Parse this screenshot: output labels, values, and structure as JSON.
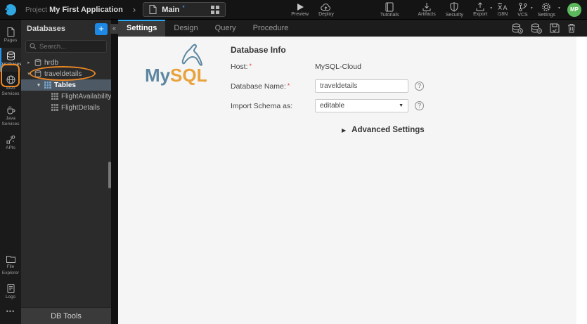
{
  "ui": {
    "required_marker": "*",
    "icons": {
      "chevron_right": "›",
      "collapse_left": "«",
      "tree_collapsed": "▸",
      "tree_expanded": "▾",
      "dropdown_caret": "▼",
      "section_collapsed": "▶",
      "help": "?",
      "unsaved_dot": "*",
      "more": "•••",
      "menu_caret": "▾",
      "add": "+"
    },
    "colors": {
      "accent_blue": "#2196f3",
      "tab_active_blue": "#29a9f4",
      "annotation_orange": "#ee8822",
      "avatar_green": "#5cb85c",
      "selected_row": "#4d5a66",
      "required_red": "#e53935",
      "mysql_blue": "#5d87a1",
      "mysql_orange": "#e8a33d"
    }
  },
  "topbar": {
    "project_prefix": "Project",
    "project_name": "My First Application",
    "page_tab": "Main",
    "actions": {
      "preview": "Preview",
      "deploy": "Deploy",
      "tutorials": "Tutorials",
      "artifacts": "Artifacts",
      "security": "Security",
      "export": "Export",
      "i18n": "I18N",
      "vcs": "VCS",
      "settings": "Settings"
    },
    "avatar_initials": "MP"
  },
  "rail": {
    "items": [
      {
        "label": "Pages"
      },
      {
        "label": "Databases",
        "active": true,
        "annotated": true
      },
      {
        "label": "Web Services"
      },
      {
        "label": "Java Services"
      },
      {
        "label": "APIs"
      }
    ],
    "bottom_items": [
      {
        "label": "File Explorer"
      },
      {
        "label": "Logs"
      }
    ]
  },
  "panel": {
    "title": "Databases",
    "search_placeholder": "Search...",
    "tree": [
      {
        "label": "hrdb",
        "level": 0,
        "expanded": false,
        "type": "database"
      },
      {
        "label": "traveldetails",
        "level": 0,
        "expanded": true,
        "type": "database",
        "annotated": true
      },
      {
        "label": "Tables",
        "level": 1,
        "expanded": true,
        "selected": true,
        "type": "tables-folder"
      },
      {
        "label": "FlightAvailability",
        "level": 2,
        "type": "table"
      },
      {
        "label": "FlightDetails",
        "level": 2,
        "type": "table"
      }
    ],
    "footer": "DB Tools"
  },
  "tabs": {
    "items": [
      {
        "label": "Settings",
        "active": true
      },
      {
        "label": "Design"
      },
      {
        "label": "Query"
      },
      {
        "label": "Procedure"
      }
    ]
  },
  "content": {
    "logo_text_my": "My",
    "logo_text_sql": "SQL",
    "heading": "Database Info",
    "fields": [
      {
        "label": "Host:",
        "required": true,
        "type": "static",
        "value": "MySQL-Cloud"
      },
      {
        "label": "Database Name:",
        "required": true,
        "type": "input",
        "value": "traveldetails",
        "help": true
      },
      {
        "label": "Import Schema as:",
        "required": false,
        "type": "select",
        "value": "editable",
        "help": true
      }
    ],
    "advanced_label": "Advanced Settings"
  }
}
